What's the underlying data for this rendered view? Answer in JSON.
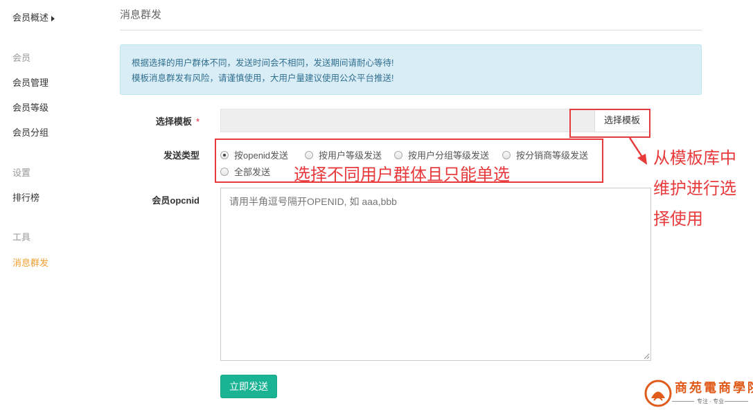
{
  "sidebar": {
    "overview": "会员概述",
    "group_member": "会员",
    "items_member": [
      "会员管理",
      "会员等级",
      "会员分组"
    ],
    "group_settings": "设置",
    "items_settings": [
      "排行榜"
    ],
    "group_tools": "工具",
    "items_tools": [
      "消息群发"
    ]
  },
  "main": {
    "title": "消息群发",
    "alert_lines": [
      "根据选择的用户群体不同，发送时间会不相同，发送期间请耐心等待!",
      "模板消息群发有风险，请谨慎使用，大用户量建议使用公众平台推送!"
    ],
    "template": {
      "label": "选择模板",
      "required_mark": "*",
      "input_value": "",
      "button_label": "选择模板"
    },
    "send_type": {
      "label": "发送类型",
      "options": [
        "按openid发送",
        "按用户等级发送",
        "按用户分组等级发送",
        "按分销商等级发送",
        "全部发送"
      ],
      "selected_index": 0
    },
    "openid": {
      "label": "会员opcnid",
      "placeholder": "请用半角逗号隔开OPENID, 如 aaa,bbb",
      "value": ""
    },
    "submit_label": "立即发送"
  },
  "annotations": {
    "radio_note": "选择不同用户群体且只能单选",
    "template_note_lines": [
      "从模板库中",
      "维护进行选",
      "择使用"
    ]
  },
  "logo": {
    "name": "商苑電商學院",
    "tagline": "专注 · 专业"
  },
  "colors": {
    "accent_active": "#f0a030",
    "submit_green": "#1ab394",
    "alert_bg": "#d9edf7",
    "annotation_red": "#e8393b"
  }
}
